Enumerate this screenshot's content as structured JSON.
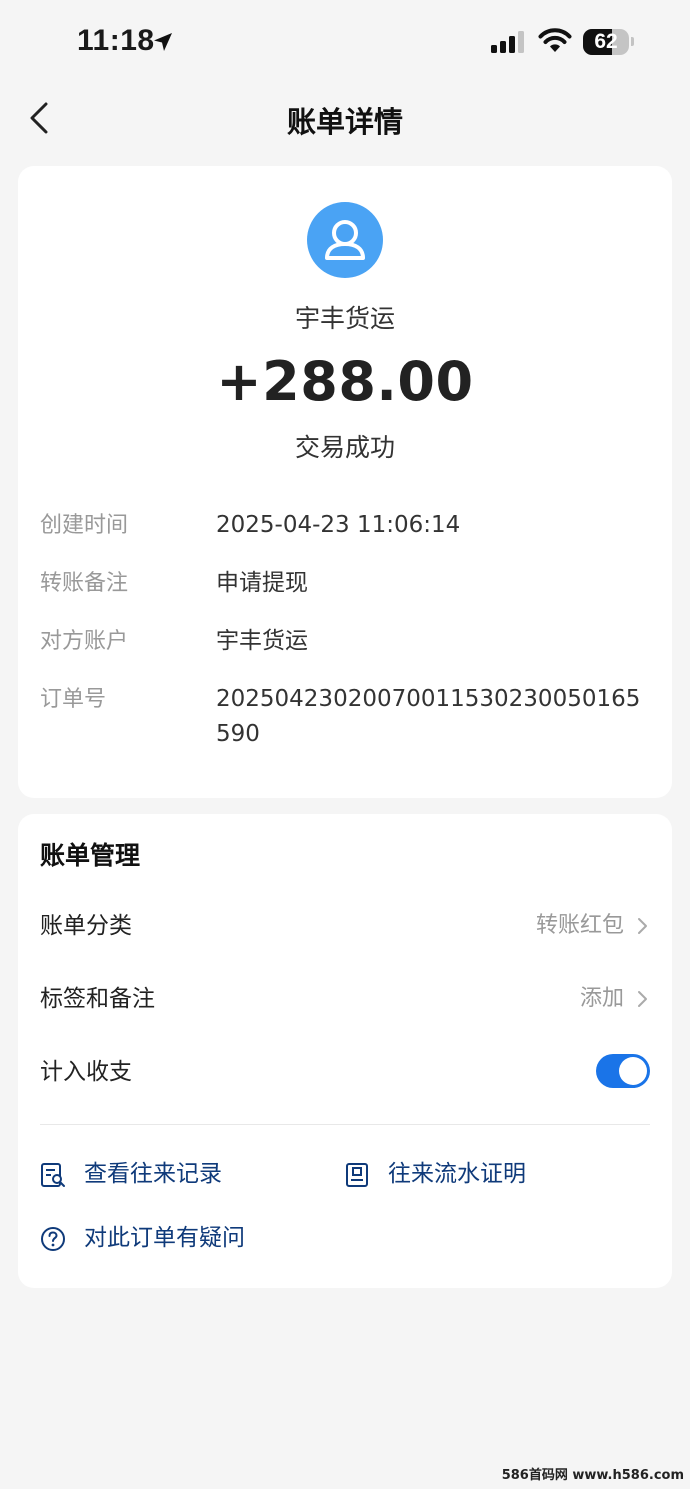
{
  "status_bar": {
    "time": "11:18",
    "battery": "62",
    "battery_level": 0.62
  },
  "nav": {
    "title": "账单详情"
  },
  "transaction": {
    "merchant": "宇丰货运",
    "amount": "+288.00",
    "status": "交易成功",
    "details": [
      {
        "label": "创建时间",
        "value": "2025-04-23 11:06:14"
      },
      {
        "label": "转账备注",
        "value": "申请提现"
      },
      {
        "label": "对方账户",
        "value": "宇丰货运"
      },
      {
        "label": "订单号",
        "value": "20250423020070011530230050165590"
      }
    ]
  },
  "management": {
    "title": "账单管理",
    "category": {
      "label": "账单分类",
      "value": "转账红包"
    },
    "tags": {
      "label": "标签和备注",
      "value": "添加"
    },
    "income": {
      "label": "计入收支",
      "enabled": true
    }
  },
  "links": {
    "records": "查看往来记录",
    "proof": "往来流水证明",
    "question": "对此订单有疑问"
  },
  "watermark": "586首码网 www.h586.com",
  "colors": {
    "accent": "#1a74e8",
    "avatar": "#4aa3f4",
    "link": "#0f3a7a"
  }
}
